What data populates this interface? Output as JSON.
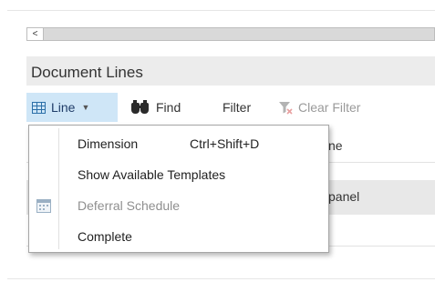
{
  "scrollbar": {
    "left_arrow": "<"
  },
  "section": {
    "title": "Document Lines"
  },
  "toolbar": {
    "line_label": "Line",
    "line_caret": "▼",
    "find_label": "Find",
    "filter_label": "Filter",
    "clear_filter_label": "Clear Filter",
    "accent_color": "#cfe6f7"
  },
  "grid": {
    "header_partial": "ne",
    "selected_row_partial": "panel"
  },
  "context_menu": {
    "items": [
      {
        "label": "Dimension",
        "shortcut": "Ctrl+Shift+D",
        "enabled": true
      },
      {
        "label": "Show Available Templates",
        "shortcut": "",
        "enabled": true
      },
      {
        "label": "Deferral Schedule",
        "shortcut": "",
        "enabled": false,
        "icon": "calendar-icon"
      },
      {
        "label": "Complete",
        "shortcut": "",
        "enabled": true
      }
    ]
  },
  "icons": {
    "line": "grid-icon",
    "find": "binoculars-icon",
    "clear_filter": "clear-filter-icon"
  }
}
